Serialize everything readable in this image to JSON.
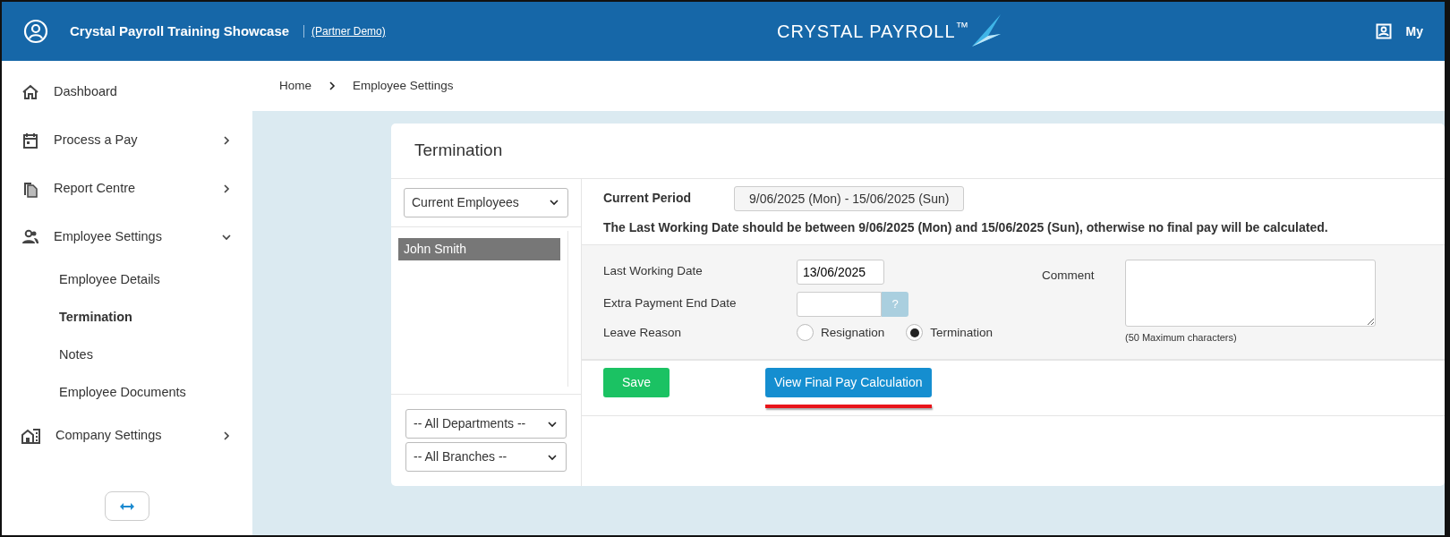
{
  "header": {
    "title": "Crystal Payroll Training Showcase",
    "subtitle_link": "(Partner Demo)",
    "logo_text": "CRYSTAL PAYROLL$^{™}$",
    "user": "My"
  },
  "sidebar": {
    "items": [
      {
        "label": "Dashboard",
        "kind": "link"
      },
      {
        "label": "Process a Pay",
        "kind": "group",
        "expanded": false
      },
      {
        "label": "Report Centre",
        "kind": "group",
        "expanded": false
      },
      {
        "label": "Employee Settings",
        "kind": "group",
        "expanded": true,
        "children": [
          {
            "label": "Employee Details",
            "selected": false
          },
          {
            "label": "Termination",
            "selected": true
          },
          {
            "label": "Notes",
            "selected": false
          },
          {
            "label": "Employee Documents",
            "selected": false
          }
        ]
      },
      {
        "label": "Company Settings",
        "kind": "group",
        "expanded": false
      }
    ]
  },
  "breadcrumb": [
    "Home",
    "Employee Settings"
  ],
  "card": {
    "title": "Termination",
    "employee_filter": "Current Employees",
    "employees": [
      {
        "name": "John Smith",
        "selected": true
      }
    ],
    "department_filter": "-- All Departments --",
    "branch_filter": "-- All Branches --",
    "current_period_label": "Current Period",
    "current_period": "9/06/2025 (Mon) - 15/06/2025 (Sun)",
    "notice": "The Last Working Date should be between 9/06/2025 (Mon) and 15/06/2025 (Sun), otherwise no final pay will be calculated.",
    "last_working_date_label": "Last Working Date",
    "last_working_date": "13/06/2025",
    "extra_payment_label": "Extra Payment End Date",
    "help_button": "?",
    "leave_reason_label": "Leave Reason",
    "leave_reasons": [
      {
        "label": "Resignation",
        "selected": false
      },
      {
        "label": "Termination",
        "selected": true
      }
    ],
    "comment_label": "Comment",
    "comment_hint": "(50 Maximum characters)",
    "save_button": "Save",
    "final_pay_button": "View Final Pay Calculation"
  }
}
